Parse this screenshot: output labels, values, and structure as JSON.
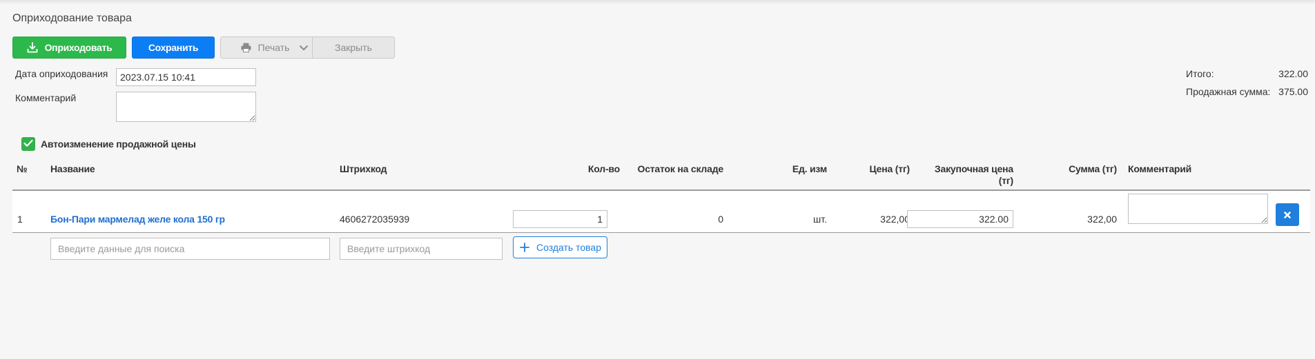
{
  "page": {
    "title": "Оприходование товара"
  },
  "toolbar": {
    "receive_label": "Оприходовать",
    "save_label": "Сохранить",
    "print_label": "Печать",
    "close_label": "Закрыть"
  },
  "form": {
    "date_label": "Дата оприходования",
    "date_value": "2023.07.15 10:41",
    "comment_label": "Комментарий",
    "comment_value": ""
  },
  "totals": {
    "total_label": "Итого:",
    "total_value": "322.00",
    "sale_label": "Продажная сумма:",
    "sale_value": "375.00"
  },
  "auto_price": {
    "label": "Автоизменение продажной цены",
    "checked": true
  },
  "table": {
    "headers": {
      "num": "№",
      "name": "Название",
      "barcode": "Штрихкод",
      "qty": "Кол-во",
      "stock": "Остаток на складе",
      "unit": "Ед. изм",
      "price": "Цена (тг)",
      "purchase_price_line1": "Закупочная цена",
      "purchase_price_line2": "(тг)",
      "sum": "Сумма (тг)",
      "comment": "Комментарий"
    },
    "rows": [
      {
        "num": "1",
        "name": "Бон-Пари мармелад желе кола 150 гр",
        "barcode": "4606272035939",
        "qty": "1",
        "stock": "0",
        "unit": "шт.",
        "price": "322,00",
        "purchase_price": "322.00",
        "sum": "322,00",
        "comment": ""
      }
    ]
  },
  "search": {
    "name_placeholder": "Введите данные для поиска",
    "barcode_placeholder": "Введите штрихкод",
    "create_label": "Создать товар"
  },
  "colors": {
    "green": "#2db84c",
    "blue": "#0c7ef5",
    "link": "#1f6fd1",
    "background": "#f6f6f6"
  },
  "icons": {
    "receive": "download-tray-icon",
    "print": "printer-icon",
    "print_dropdown": "chevron-down-icon",
    "checkbox": "checkmark-icon",
    "delete": "close-icon",
    "create": "plus-icon"
  }
}
